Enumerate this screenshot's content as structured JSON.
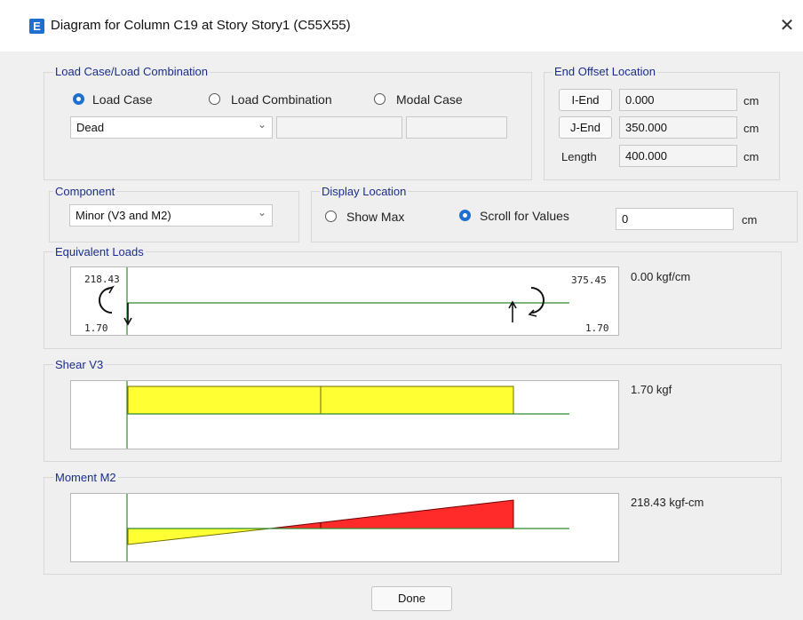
{
  "window": {
    "title": "Diagram for Column C19 at Story Story1 (C55X55)",
    "app_icon_letter": "E",
    "close_glyph": "✕"
  },
  "load_case_group": {
    "label": "Load Case/Load Combination",
    "options": [
      "Load Case",
      "Load Combination",
      "Modal Case"
    ],
    "selected": "Load Case",
    "case_value": "Dead"
  },
  "end_offset_group": {
    "label": "End Offset Location",
    "i_end_label": "I-End",
    "i_end_value": "0.000",
    "j_end_label": "J-End",
    "j_end_value": "350.000",
    "length_label": "Length",
    "length_value": "400.000",
    "unit": "cm"
  },
  "component_group": {
    "label": "Component",
    "value": "Minor (V3 and M2)"
  },
  "display_location_group": {
    "label": "Display Location",
    "options": [
      "Show Max",
      "Scroll for Values"
    ],
    "selected": "Scroll for Values",
    "scroll_value": "0",
    "unit": "cm"
  },
  "equivalent_loads": {
    "label": "Equivalent Loads",
    "left_moment": "218.43",
    "right_moment": "375.45",
    "left_force": "1.70",
    "right_force": "1.70",
    "value_text": "0.00 kgf/cm"
  },
  "shear": {
    "label": "Shear V3",
    "value_text": "1.70 kgf"
  },
  "moment": {
    "label": "Moment M2",
    "value_text": "218.43 kgf-cm"
  },
  "done_label": "Done",
  "colors": {
    "accent": "#1e6fd0",
    "label_blue": "#1a2d8c",
    "shear_fill": "#ffff33",
    "moment_pos": "#ff2a2a",
    "moment_neg": "#ffff33",
    "axis": "#2e8b2e"
  }
}
